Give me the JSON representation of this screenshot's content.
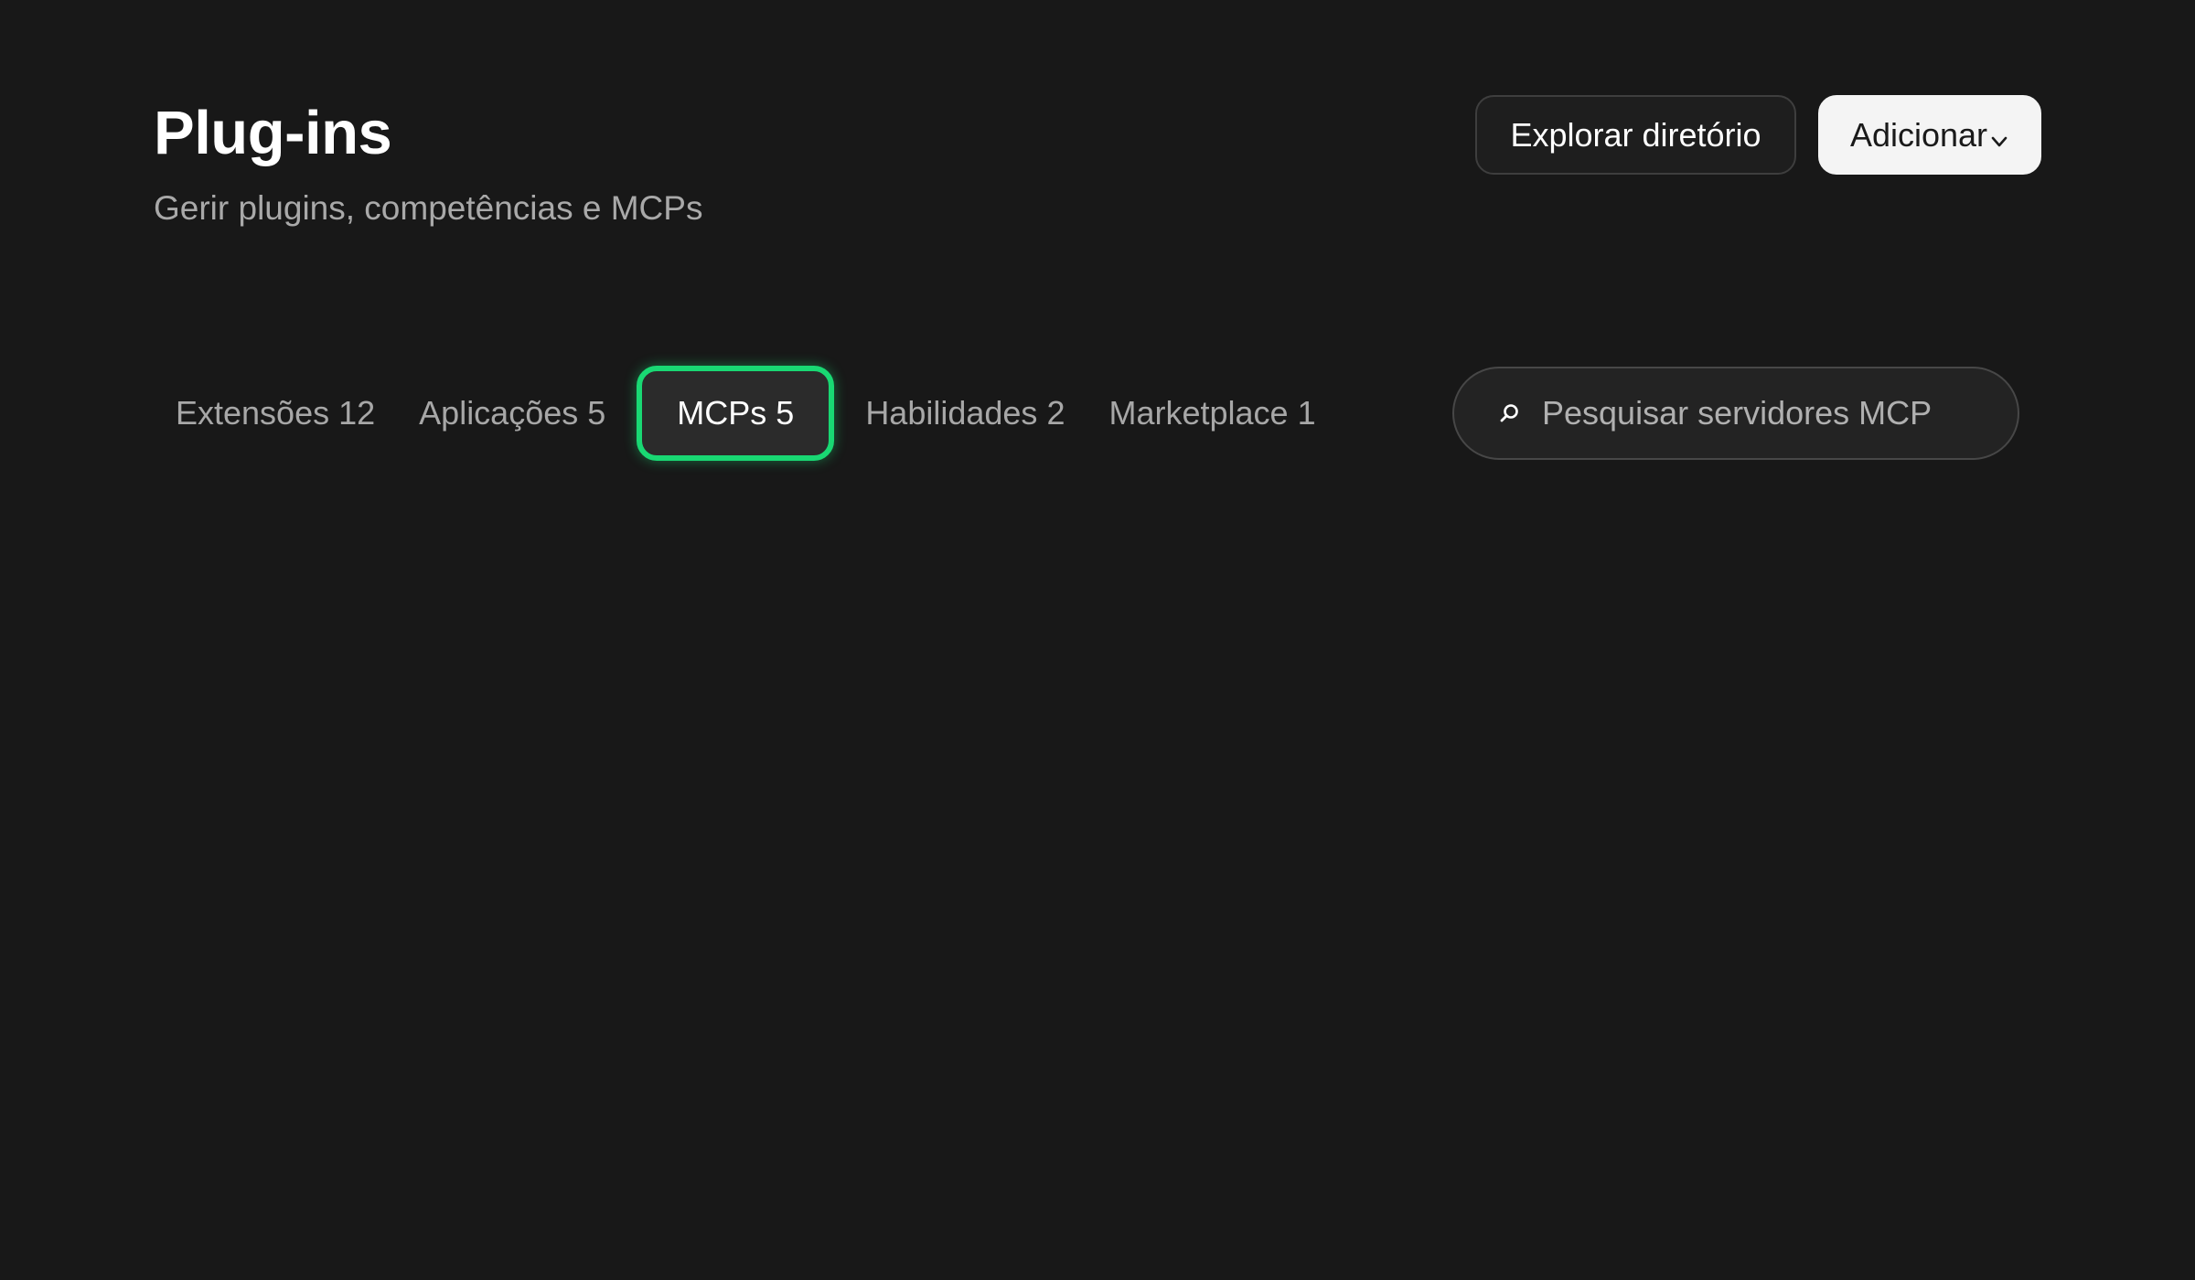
{
  "header": {
    "title": "Plug-ins",
    "subtitle": "Gerir plugins, competências e MCPs"
  },
  "actions": {
    "explore_label": "Explorar diretório",
    "add_label": "Adicionar",
    "add_icon": "chevron-down-icon"
  },
  "tabs": [
    {
      "label": "Extensões",
      "count": "12",
      "active": false
    },
    {
      "label": "Aplicações",
      "count": "5",
      "active": false
    },
    {
      "label": "MCPs",
      "count": "5",
      "active": true
    },
    {
      "label": "Habilidades",
      "count": "2",
      "active": false
    },
    {
      "label": "Marketplace",
      "count": "1",
      "active": false
    }
  ],
  "search": {
    "icon": "search-icon",
    "placeholder": "Pesquisar servidores MCP",
    "value": ""
  },
  "colors": {
    "background": "#181818",
    "active_tab_border": "#19d873",
    "primary_button_bg": "#f4f4f4"
  }
}
